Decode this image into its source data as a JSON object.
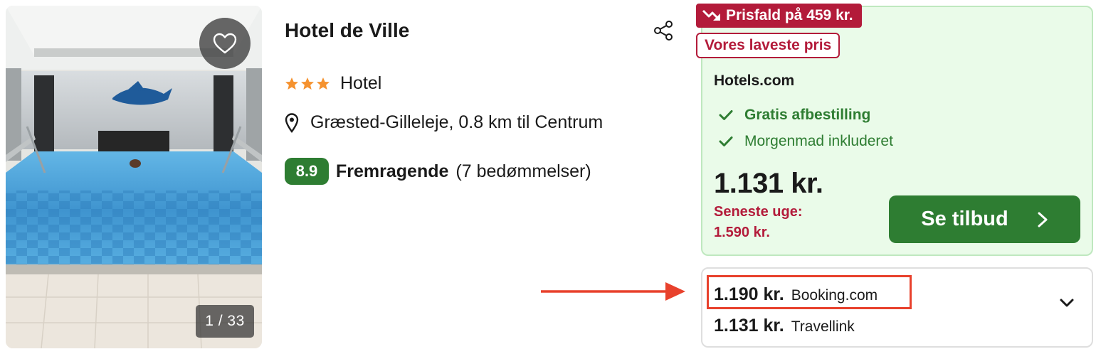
{
  "hotel": {
    "name": "Hotel de Ville",
    "stars": 3,
    "type": "Hotel",
    "location": "Græsted-Gilleleje, 0.8 km til Centrum",
    "score": "8.9",
    "rating_label": "Fremragende",
    "rating_count": "(7 bedømmelser)"
  },
  "photo": {
    "counter": "1 / 33"
  },
  "deal": {
    "price_drop_badge": "Prisfald på 459 kr.",
    "lowest_price_badge": "Vores laveste pris",
    "provider": "Hotels.com",
    "perks": [
      "Gratis afbestilling",
      "Morgenmad inkluderet"
    ],
    "price": "1.131 kr.",
    "previous_label": "Seneste uge:",
    "previous_price": "1.590 kr.",
    "cta_label": "Se tilbud"
  },
  "other_offers": [
    {
      "price": "1.190 kr.",
      "provider": "Booking.com"
    },
    {
      "price": "1.131 kr.",
      "provider": "Travellink"
    }
  ],
  "colors": {
    "green": "#2e7d32",
    "deal_bg": "#eafbe9",
    "red": "#b31b3a",
    "star": "#f5922f",
    "annotation": "#e8412c"
  },
  "icons": {
    "favorite": "heart-icon",
    "share": "share-icon",
    "location": "map-pin-icon",
    "price_drop": "trend-down-icon",
    "perk": "check-icon",
    "cta": "chevron-right-icon",
    "expand": "chevron-down-icon"
  }
}
